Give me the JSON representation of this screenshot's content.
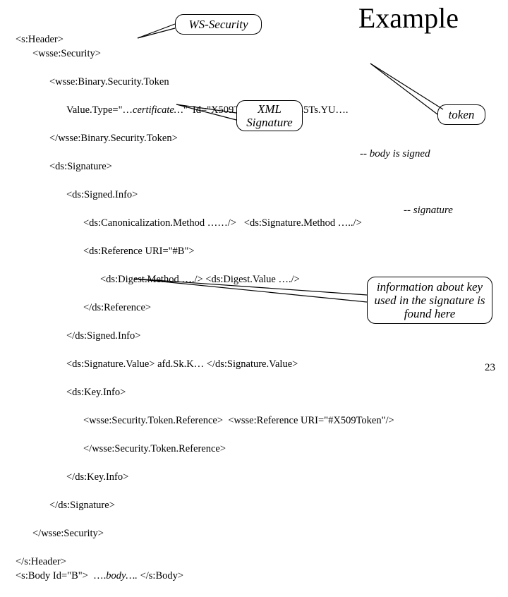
{
  "title": "Example",
  "page_number": "23",
  "callouts": {
    "ws": "WS-Security",
    "xml": "XML Signature",
    "token": "token",
    "keyinfo": "information about key used in the signature is found here"
  },
  "annot": {
    "body_signed": "-- body is signed",
    "signature": "-- signature"
  },
  "code": {
    "l01": "<s:Header>",
    "l02": "<wsse:Security>",
    "l03": "<wsse:Binary.Security.Token",
    "l04a": "Value.Type=\"…",
    "l04b": "certificate…",
    "l04c": "\"  Id=\"X509Token\">  x.Dee45Ts.YU….",
    "l05": "</wsse:Binary.Security.Token>",
    "l06": "<ds:Signature>",
    "l07": "<ds:Signed.Info>",
    "l08": "<ds:Canonicalization.Method ……/>   <ds:Signature.Method …../>",
    "l09": "<ds:Reference URI=\"#B\">",
    "l10": "<ds:Digest.Method …./> <ds:Digest.Value …./>",
    "l11": "</ds:Reference>",
    "l12": "</ds:Signed.Info>",
    "l13": "<ds:Signature.Value> afd.Sk.K… </ds:Signature.Value>",
    "l14": "<ds:Key.Info>",
    "l15": "<wsse:Security.Token.Reference>  <wsse:Reference URI=\"#X509Token\"/>",
    "l16": "</wsse:Security.Token.Reference>",
    "l17": "</ds:Key.Info>",
    "l18": "</ds:Signature>",
    "l19": "</wsse:Security>",
    "l20": "</s:Header>",
    "l21a": "<s:Body Id=\"B\">  ….",
    "l21b": "body….",
    "l21c": " </s:Body>"
  }
}
